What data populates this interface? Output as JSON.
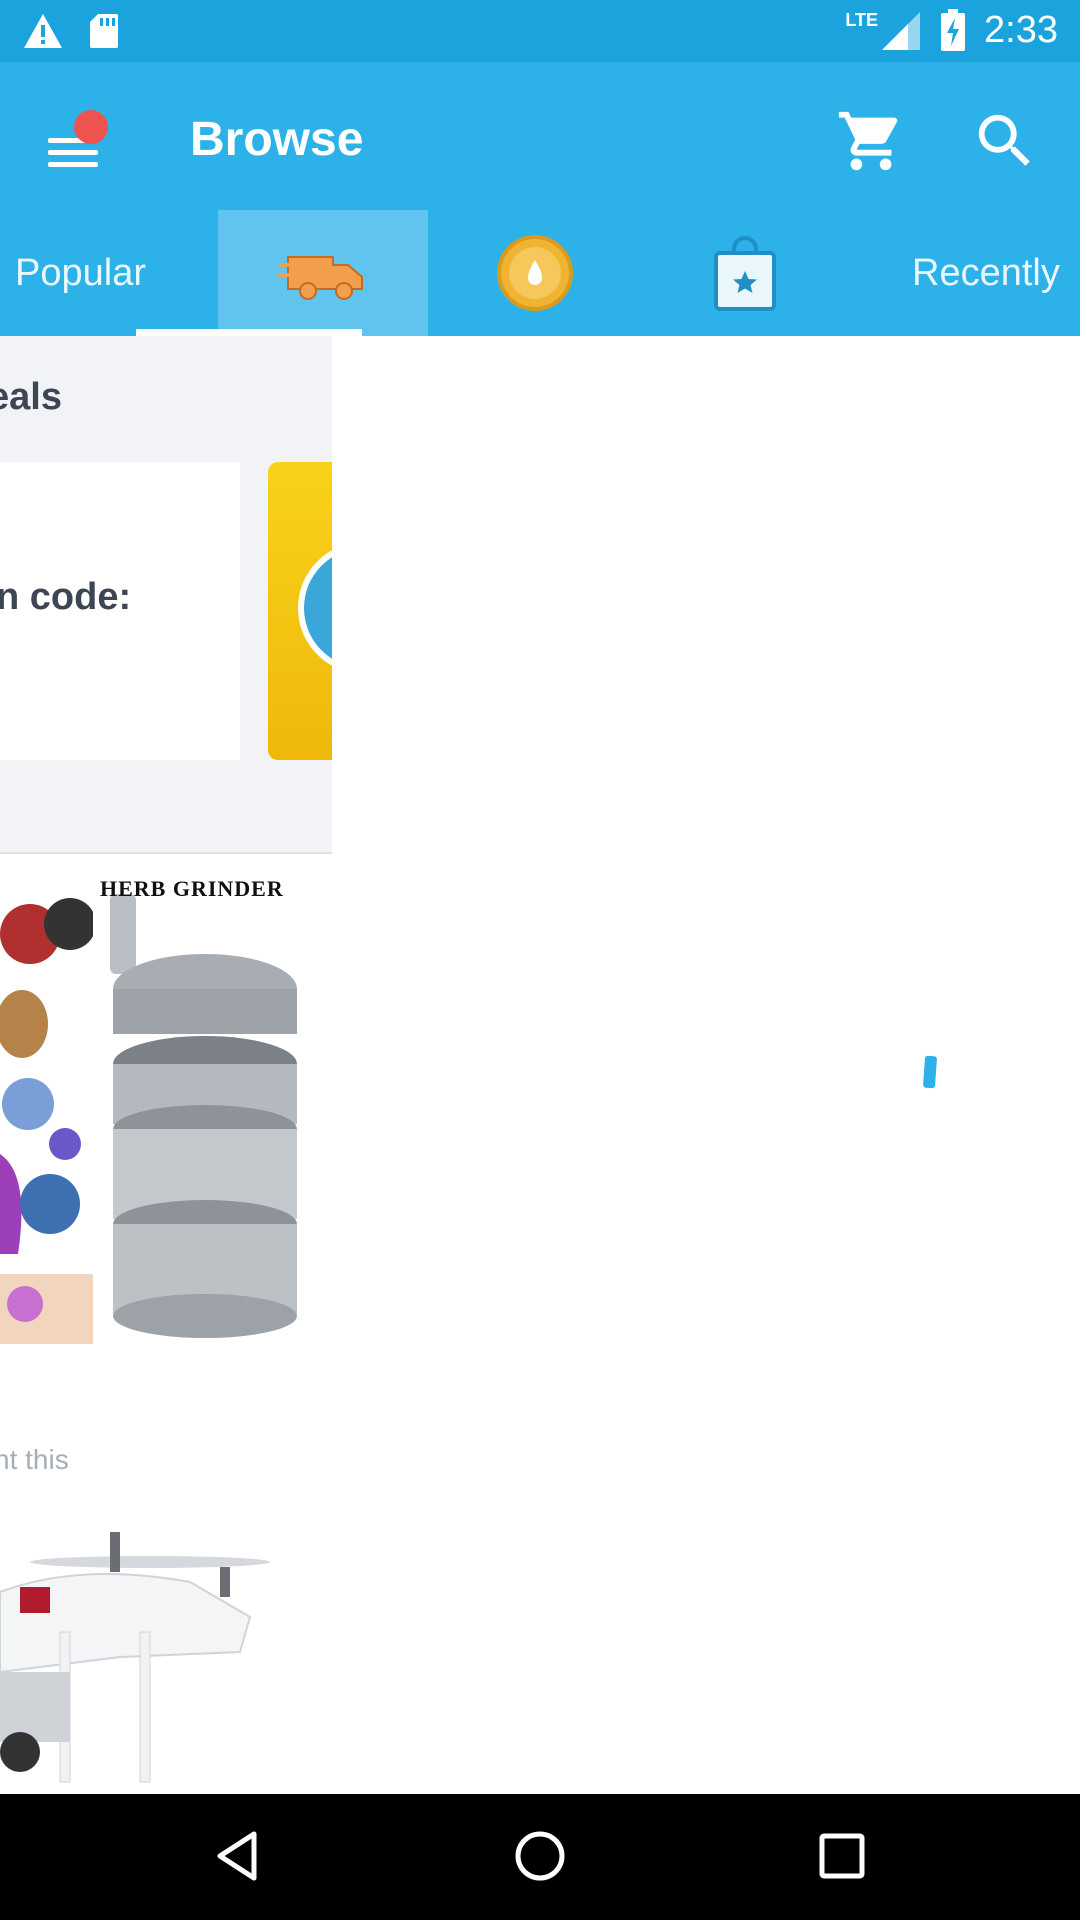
{
  "status_bar": {
    "time": "2:33",
    "network": "LTE",
    "icons": [
      "warning-icon",
      "sd-card-icon",
      "signal-icon",
      "battery-charging-icon"
    ]
  },
  "app_bar": {
    "title": "Browse",
    "icons": [
      "menu-icon",
      "cart-icon",
      "search-icon"
    ],
    "has_notification": true
  },
  "tabs": [
    {
      "label": "Popular"
    },
    {
      "icon": "fast-delivery-icon",
      "selected": true
    },
    {
      "icon": "coin-icon"
    },
    {
      "icon": "shopping-bag-star-icon"
    },
    {
      "label": "Recently"
    }
  ],
  "deals": {
    "title": "eals",
    "card_text": "n code:"
  },
  "product": {
    "image_label": "HERB GRINDER",
    "subtext": "nt this"
  },
  "nav_bar": {
    "icons": [
      "back-icon",
      "home-icon",
      "recents-icon"
    ]
  },
  "colors": {
    "status_bar": "#1aa3dd",
    "app_bar": "#2cb1e9",
    "accent_orange": "#f29e4c",
    "coin_gold": "#f0b431"
  }
}
